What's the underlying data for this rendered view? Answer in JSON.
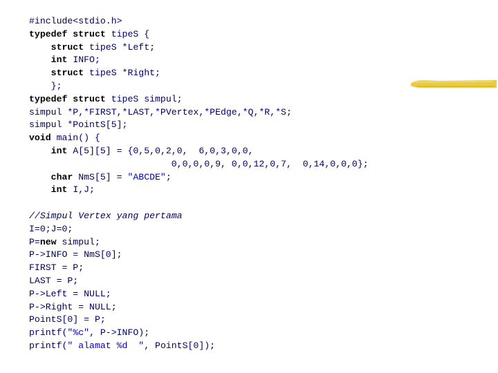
{
  "slide": {
    "highlight_color": "#e8c83a",
    "text_color": "#000066",
    "keyword_color": "#000000",
    "string_color": "#0000cc"
  },
  "code": {
    "lines": [
      [
        {
          "t": "#include<stdio.h>",
          "c": ""
        }
      ],
      [
        {
          "t": "typedef struct",
          "c": "kw"
        },
        {
          "t": " tipeS {",
          "c": ""
        }
      ],
      [
        {
          "t": "    ",
          "c": ""
        },
        {
          "t": "struct",
          "c": "kw"
        },
        {
          "t": " tipeS *Left;",
          "c": ""
        }
      ],
      [
        {
          "t": "    ",
          "c": ""
        },
        {
          "t": "int",
          "c": "kw"
        },
        {
          "t": " INFO;",
          "c": ""
        }
      ],
      [
        {
          "t": "    ",
          "c": ""
        },
        {
          "t": "struct",
          "c": "kw"
        },
        {
          "t": " tipeS *Right;",
          "c": ""
        }
      ],
      [
        {
          "t": "    };",
          "c": ""
        }
      ],
      [
        {
          "t": "typedef struct",
          "c": "kw"
        },
        {
          "t": " tipeS simpul;",
          "c": ""
        }
      ],
      [
        {
          "t": "simpul *P,*FIRST,*LAST,*PVertex,*PEdge,*Q,*R,*S;",
          "c": ""
        }
      ],
      [
        {
          "t": "simpul *PointS[5];",
          "c": ""
        }
      ],
      [
        {
          "t": "void",
          "c": "kw"
        },
        {
          "t": " main() {",
          "c": ""
        }
      ],
      [
        {
          "t": "    ",
          "c": ""
        },
        {
          "t": "int",
          "c": "kw"
        },
        {
          "t": " A[5][5] = {0,5,0,2,0,  6,0,3,0,0,",
          "c": ""
        }
      ],
      [
        {
          "t": "                          0,0,0,0,9, 0,0,12,0,7,  0,14,0,0,0};",
          "c": ""
        }
      ],
      [
        {
          "t": "    ",
          "c": ""
        },
        {
          "t": "char",
          "c": "kw"
        },
        {
          "t": " NmS[5] = ",
          "c": ""
        },
        {
          "t": "\"ABCDE\"",
          "c": "str"
        },
        {
          "t": ";",
          "c": ""
        }
      ],
      [
        {
          "t": "    ",
          "c": ""
        },
        {
          "t": "int",
          "c": "kw"
        },
        {
          "t": " I,J;",
          "c": ""
        }
      ],
      [],
      [
        {
          "t": "//Simpul Vertex yang pertama",
          "c": "cmt"
        }
      ],
      [
        {
          "t": "I=0;J=0;",
          "c": ""
        }
      ],
      [
        {
          "t": "P=",
          "c": ""
        },
        {
          "t": "new",
          "c": "kw"
        },
        {
          "t": " simpul;",
          "c": ""
        }
      ],
      [
        {
          "t": "P->INFO = NmS[0];",
          "c": ""
        }
      ],
      [
        {
          "t": "FIRST = P;",
          "c": ""
        }
      ],
      [
        {
          "t": "LAST = P;",
          "c": ""
        }
      ],
      [
        {
          "t": "P->Left = NULL;",
          "c": ""
        }
      ],
      [
        {
          "t": "P->Right = NULL;",
          "c": ""
        }
      ],
      [
        {
          "t": "PointS[0] = P;",
          "c": ""
        }
      ],
      [
        {
          "t": "printf(",
          "c": ""
        },
        {
          "t": "\"%c\"",
          "c": "str"
        },
        {
          "t": ", P->INFO);",
          "c": ""
        }
      ],
      [
        {
          "t": "printf(",
          "c": ""
        },
        {
          "t": "\" alamat %d  \"",
          "c": "str"
        },
        {
          "t": ", PointS[0]);",
          "c": ""
        }
      ]
    ]
  }
}
